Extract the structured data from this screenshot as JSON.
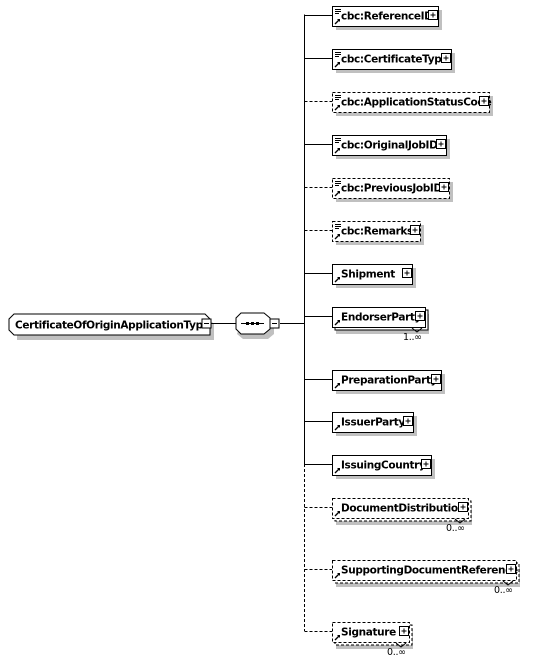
{
  "root": {
    "name": "CertificateOfOriginApplicationType",
    "expander": "collapse",
    "compositor": "sequence"
  },
  "elements": [
    {
      "name": "cbc:ReferenceID",
      "optional": false,
      "has_doc": true,
      "occurrence": ""
    },
    {
      "name": "cbc:CertificateType",
      "optional": false,
      "has_doc": true,
      "occurrence": ""
    },
    {
      "name": "cbc:ApplicationStatusCode",
      "optional": true,
      "has_doc": true,
      "occurrence": ""
    },
    {
      "name": "cbc:OriginalJobID",
      "optional": false,
      "has_doc": true,
      "occurrence": ""
    },
    {
      "name": "cbc:PreviousJobID",
      "optional": true,
      "has_doc": true,
      "occurrence": ""
    },
    {
      "name": "cbc:Remarks",
      "optional": true,
      "has_doc": true,
      "occurrence": ""
    },
    {
      "name": "Shipment",
      "optional": false,
      "has_doc": false,
      "occurrence": ""
    },
    {
      "name": "EndorserParty",
      "optional": false,
      "has_doc": false,
      "occurrence": "1..∞"
    },
    {
      "name": "PreparationParty",
      "optional": false,
      "has_doc": false,
      "occurrence": ""
    },
    {
      "name": "IssuerParty",
      "optional": false,
      "has_doc": false,
      "occurrence": ""
    },
    {
      "name": "IssuingCountry",
      "optional": false,
      "has_doc": false,
      "occurrence": ""
    },
    {
      "name": "DocumentDistribution",
      "optional": true,
      "has_doc": false,
      "occurrence": "0..∞"
    },
    {
      "name": "SupportingDocumentReference",
      "optional": true,
      "has_doc": false,
      "occurrence": "0..∞"
    },
    {
      "name": "Signature",
      "optional": true,
      "has_doc": false,
      "occurrence": "0..∞"
    }
  ],
  "colors": {
    "line": "#000000",
    "shadow": "#c0c0c0",
    "box_fill": "#ffffff"
  }
}
